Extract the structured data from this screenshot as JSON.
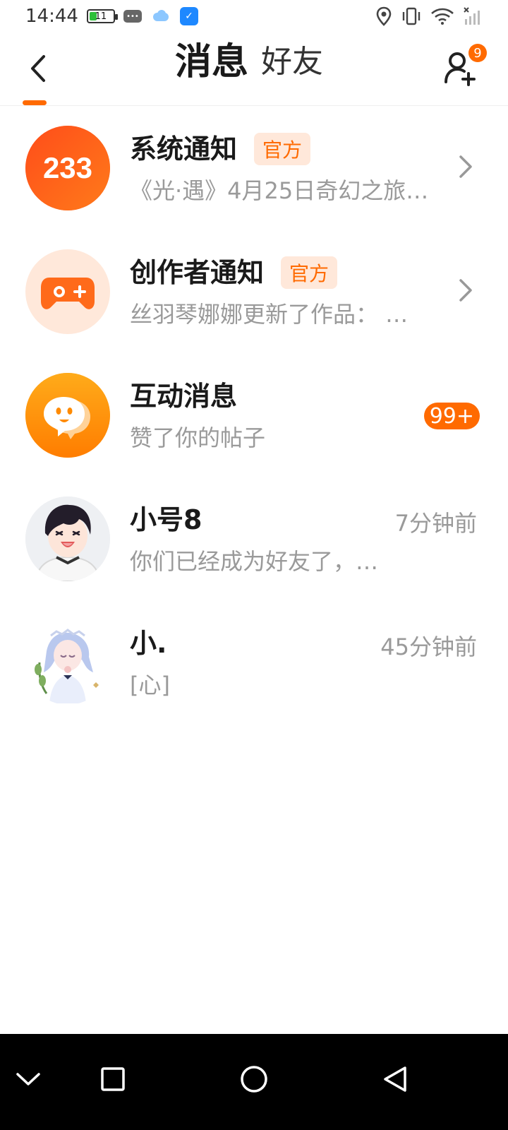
{
  "status_bar": {
    "time": "14:44",
    "battery": "11",
    "icons": [
      "battery-icon",
      "message-notification-icon",
      "cloud-icon",
      "shield-app-icon",
      "location-icon",
      "vibrate-icon",
      "wifi-icon",
      "signal-icon"
    ]
  },
  "header": {
    "back_icon": "back-icon",
    "tabs": [
      {
        "label": "消息",
        "active": true
      },
      {
        "label": "好友",
        "active": false
      }
    ],
    "add_friend_icon": "add-friend-icon",
    "add_friend_badge": "9"
  },
  "messages": [
    {
      "title": "系统通知",
      "badge": "官方",
      "preview": "《光·遇》4月25日奇幻之旅…",
      "avatar_text": "233",
      "avatar_color": "#ff5a1f",
      "trailing": "chevron"
    },
    {
      "title": "创作者通知",
      "badge": "官方",
      "preview": "丝羽琴娜娜更新了作品：  …",
      "avatar_icon": "gamepad-icon",
      "avatar_color": "#ffe8da",
      "trailing": "chevron"
    },
    {
      "title": "互动消息",
      "preview": "赞了你的帖子",
      "avatar_icon": "chat-face-icon",
      "avatar_color": "#ff9a00",
      "count": "99+"
    },
    {
      "title": "小号8",
      "preview": "你们已经成为好友了，…",
      "time": "7分钟前"
    },
    {
      "title": "小.",
      "preview": "[心]",
      "time": "45分钟前"
    }
  ],
  "colors": {
    "accent": "#ff6a00",
    "badge_bg": "#ffe8da",
    "secondary_text": "#9a9a9a"
  },
  "nav_bar": {
    "icons": [
      "collapse-icon",
      "recents-icon",
      "home-icon",
      "back-nav-icon"
    ]
  }
}
